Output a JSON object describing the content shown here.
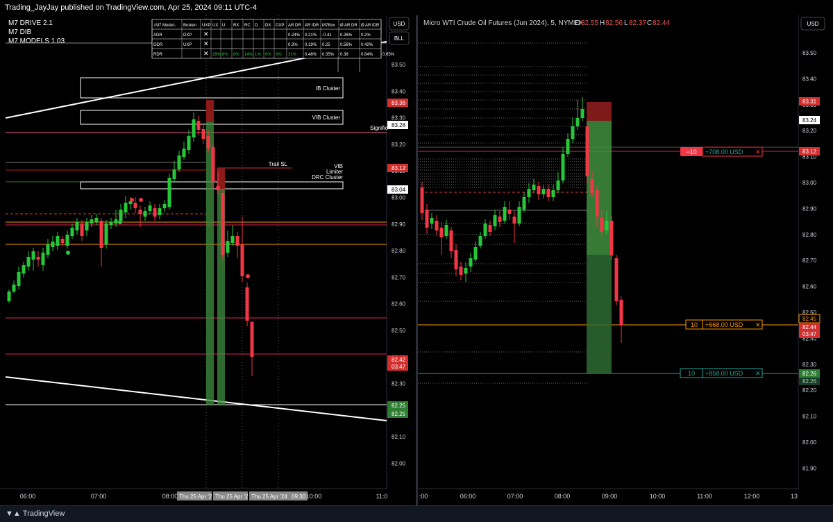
{
  "publish_line": "Trading_JayJay published on TradingView.com, Apr 25, 2024 09:11 UTC-4",
  "brand": "TradingView",
  "left": {
    "indicators": [
      "M7 DRIVE 2.1",
      "M7 DIB",
      "M7 MODELS 1.03"
    ],
    "table": {
      "headers": [
        "↓M7 Model↓",
        "Broken",
        "UXP",
        "UX",
        "U",
        "RX",
        "RC",
        "D",
        "DX",
        "DXP",
        "AR DR",
        "AR IDR",
        "M7Box",
        "Ø AR DR",
        "Ø AR IDR"
      ],
      "rows": [
        [
          "ADR",
          "DXP",
          "✕",
          "",
          "",
          "",
          "",
          "",
          "",
          "",
          "0.24%",
          "0.21%",
          "-0.41",
          "0.26%",
          "0.2%"
        ],
        [
          "ODR",
          "UXP",
          "✕",
          "",
          "",
          "",
          "",
          "",
          "",
          "",
          "0.3%",
          "0.19%",
          "0.25",
          "0.56%",
          "0.42%"
        ],
        [
          "RDR",
          "",
          "✕",
          "28%",
          "6%",
          "8%",
          "14%",
          "1%",
          "6%",
          "6%",
          "31%",
          "0.48%",
          "0.35%",
          "0.38",
          "0.84%",
          "0.65%"
        ]
      ]
    },
    "currency_btn": "USD",
    "bll_btn": "BLL",
    "boxes": [
      "IB Cluster",
      "VIB Cluster",
      "DRC Cluster"
    ],
    "labels": {
      "trail": "Trail SL",
      "vib": "VIB",
      "limiter": "Limiter",
      "signific": "Signific"
    },
    "axis_ticks": [
      "83.50",
      "83.40",
      "83.30",
      "83.20",
      "83.10",
      "83.00",
      "82.90",
      "82.80",
      "82.70",
      "82.60",
      "82.50",
      "82.40",
      "82.30",
      "82.20",
      "82.10",
      "82.00"
    ],
    "price_tags": {
      "p8336": "83.36",
      "p8328": "83.28",
      "p8312": "83.12",
      "p8304": "83.04",
      "p8242": "82.42",
      "p8242_timer": "03:47",
      "p8225a": "82.25",
      "p8225b": "82.25"
    },
    "time_labels": [
      "06:00",
      "07:00",
      "08:00",
      "10:00",
      "11:0"
    ],
    "time_tags": [
      "Thu 25 Apr '2",
      "Thu 25 Apr '2",
      "Thu 25 Apr '24",
      "09:30"
    ]
  },
  "right": {
    "symbol_title": "Micro WTI Crude Oil Futures (Jun 2024), 5, NYMEX",
    "ohlc": {
      "o_label": "O",
      "o": "82.55",
      "h_label": "H",
      "h": "82.56",
      "l_label": "L",
      "l": "82.37",
      "c_label": "C",
      "c": "82.44"
    },
    "currency_btn": "USD",
    "axis_ticks": [
      "83.50",
      "83.40",
      "83.30",
      "83.20",
      "83.10",
      "83.00",
      "82.90",
      "82.80",
      "82.70",
      "82.60",
      "82.50",
      "82.40",
      "82.30",
      "82.20",
      "82.10",
      "82.00",
      "81.90"
    ],
    "price_tags": {
      "p8331": "83.31",
      "p8324": "83.24",
      "p8312": "83.12",
      "p8245": "82.45",
      "p8244": "82.44",
      "p8244_timer": "03:47",
      "p8226a": "82.26",
      "p8226b": "82.26"
    },
    "orders": [
      {
        "qty": "−10",
        "pnl": "+708.00 USD",
        "close": "✕"
      },
      {
        "qty": "10",
        "pnl": "+668.00 USD",
        "close": "✕"
      },
      {
        "qty": "10",
        "pnl": "+858.00 USD",
        "close": "✕"
      }
    ],
    "time_labels": [
      ":00",
      "06:00",
      "07:00",
      "08:00",
      "09:00",
      "10:00",
      "11:00",
      "12:00",
      "13"
    ]
  }
}
